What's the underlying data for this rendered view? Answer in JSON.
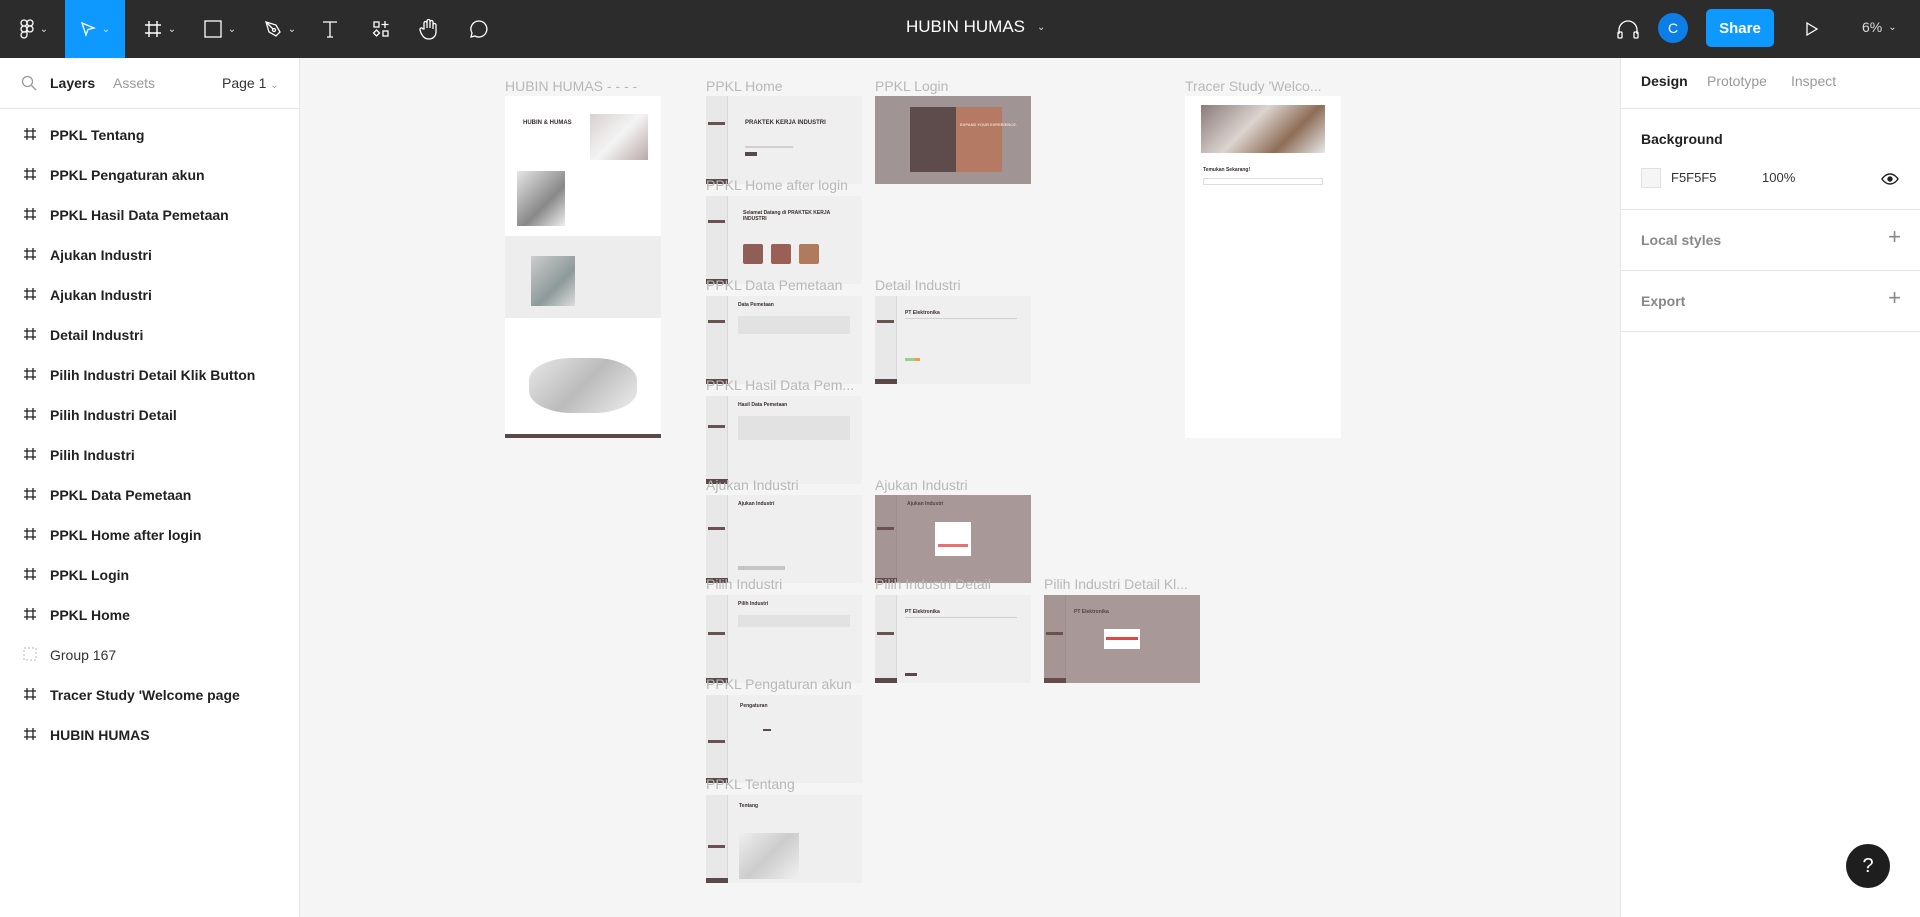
{
  "toolbar": {
    "tools": [
      {
        "name": "main-menu",
        "icon": "figma-logo-icon"
      },
      {
        "name": "move",
        "icon": "cursor-icon",
        "active": true
      },
      {
        "name": "frame",
        "icon": "frame-icon"
      },
      {
        "name": "shape",
        "icon": "rectangle-icon"
      },
      {
        "name": "pen",
        "icon": "pen-icon"
      },
      {
        "name": "text",
        "icon": "text-icon"
      },
      {
        "name": "resources",
        "icon": "components-icon"
      },
      {
        "name": "hand",
        "icon": "hand-icon"
      },
      {
        "name": "comment",
        "icon": "comment-icon"
      }
    ],
    "file_title": "HUBIN HUMAS",
    "avatar_initial": "C",
    "share_label": "Share",
    "zoom_level": "6%",
    "accent_color": "#0d99ff"
  },
  "left_panel": {
    "tabs": {
      "layers": "Layers",
      "assets": "Assets"
    },
    "page_selector": "Page 1",
    "layers": [
      {
        "label": "PPKL Tentang",
        "type": "frame"
      },
      {
        "label": "PPKL Pengaturan akun",
        "type": "frame"
      },
      {
        "label": "PPKL Hasil Data Pemetaan",
        "type": "frame"
      },
      {
        "label": "Ajukan Industri",
        "type": "frame"
      },
      {
        "label": "Ajukan Industri",
        "type": "frame"
      },
      {
        "label": "Detail Industri",
        "type": "frame"
      },
      {
        "label": "Pilih Industri Detail Klik Button",
        "type": "frame"
      },
      {
        "label": "Pilih Industri Detail",
        "type": "frame"
      },
      {
        "label": "Pilih Industri",
        "type": "frame"
      },
      {
        "label": "PPKL Data Pemetaan",
        "type": "frame"
      },
      {
        "label": "PPKL Home after login",
        "type": "frame"
      },
      {
        "label": "PPKL Login",
        "type": "frame"
      },
      {
        "label": "PPKL Home",
        "type": "frame"
      },
      {
        "label": "Group 167",
        "type": "group"
      },
      {
        "label": "Tracer Study 'Welcome page",
        "type": "frame"
      },
      {
        "label": "HUBIN HUMAS",
        "type": "frame"
      }
    ]
  },
  "right_panel": {
    "tabs": {
      "design": "Design",
      "prototype": "Prototype",
      "inspect": "Inspect"
    },
    "background": {
      "title": "Background",
      "hex": "F5F5F5",
      "opacity": "100%"
    },
    "local_styles": "Local styles",
    "export": "Export"
  },
  "canvas": {
    "frames": [
      {
        "label": "HUBIN HUMAS - - - -",
        "content_title": "HUBIN & HUMAS"
      },
      {
        "label": "PPKL Home",
        "content_title": "PRAKTEK KERJA INDUSTRI"
      },
      {
        "label": "PPKL Login",
        "content_title": "EXPAND YOUR EXPERIENCE."
      },
      {
        "label": "Tracer Study 'Welco...",
        "content_title": "Temukan Sekarang!"
      },
      {
        "label": "PPKL Home after login",
        "content_title": "Selamat Datang di PRAKTEK KERJA INDUSTRI"
      },
      {
        "label": "PPKL Data Pemetaan",
        "content_title": "Data Pemetaan"
      },
      {
        "label": "Detail Industri",
        "content_title": "PT Elektronika"
      },
      {
        "label": "PPKL Hasil Data Pem...",
        "content_title": "Hasil Data Pemetaan"
      },
      {
        "label": "Ajukan Industri",
        "content_title": "Ajukan Industri"
      },
      {
        "label": "Ajukan Industri",
        "content_title": "Ajukan Industri"
      },
      {
        "label": "Pilih Industri",
        "content_title": "Pilih Industri"
      },
      {
        "label": "Pilih Industri Detail",
        "content_title": "PT Elektronika"
      },
      {
        "label": "Pilih Industri Detail Kl...",
        "content_title": "PT Elektronika"
      },
      {
        "label": "PPKL Pengaturan akun",
        "content_title": "Pengaturan"
      },
      {
        "label": "PPKL Tentang",
        "content_title": "Tentang"
      }
    ]
  },
  "help_label": "?"
}
